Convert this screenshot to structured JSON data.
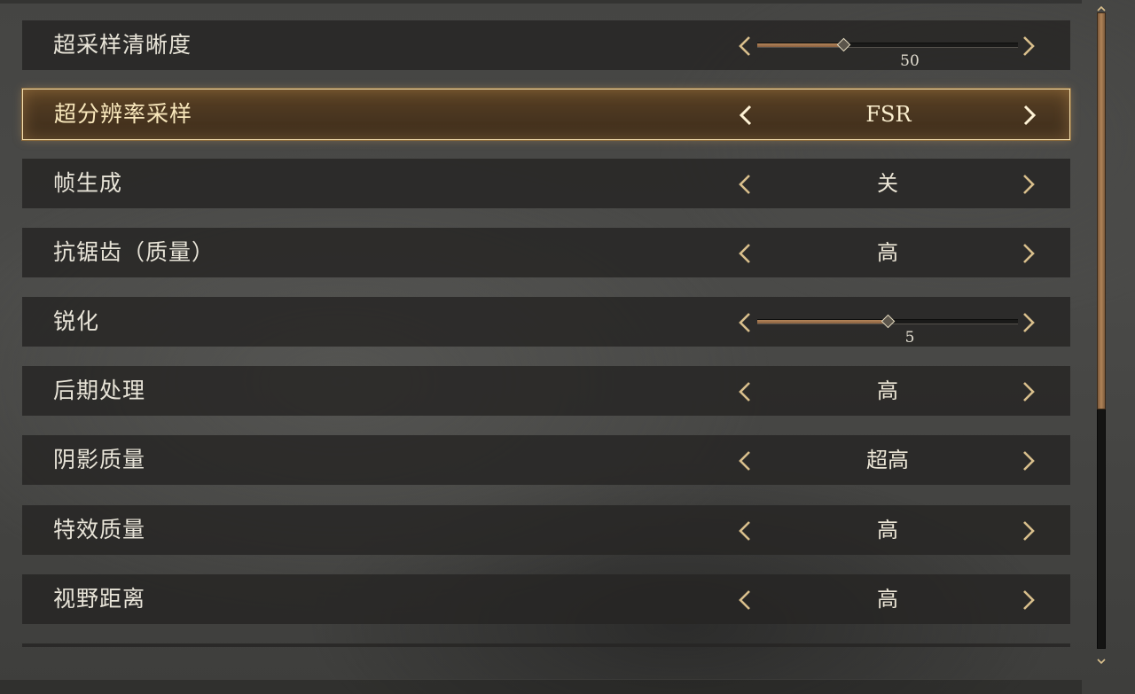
{
  "settings": [
    {
      "label": "超采样清晰度",
      "type": "slider",
      "value": "50",
      "fraction": 0.33
    },
    {
      "label": "超分辨率采样",
      "type": "select",
      "value": "FSR",
      "selected": true
    },
    {
      "label": "帧生成",
      "type": "select",
      "value": "关"
    },
    {
      "label": "抗锯齿（质量）",
      "type": "select",
      "value": "高"
    },
    {
      "label": "锐化",
      "type": "slider",
      "value": "5",
      "fraction": 0.5
    },
    {
      "label": "后期处理",
      "type": "select",
      "value": "高"
    },
    {
      "label": "阴影质量",
      "type": "select",
      "value": "超高"
    },
    {
      "label": "特效质量",
      "type": "select",
      "value": "高"
    },
    {
      "label": "视野距离",
      "type": "select",
      "value": "高"
    }
  ],
  "scrollbar": {
    "position_fraction": 0.0,
    "visible_fraction": 0.62
  },
  "icons": {
    "prev": "chevron-left-icon",
    "next": "chevron-right-icon"
  },
  "colors": {
    "accent": "#d9bf8c",
    "selected_border": "#f4dfae",
    "slider_fill": "#b4865a",
    "scroll_handle": "#b08358"
  }
}
